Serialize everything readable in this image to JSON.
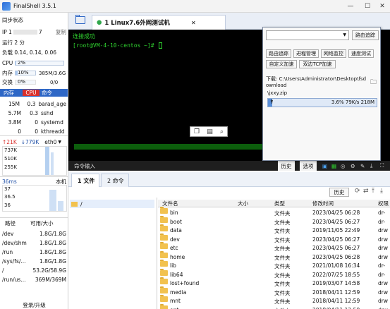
{
  "app": {
    "title": "FinalShell 3.5.1"
  },
  "left": {
    "sync_status": "同步状态",
    "ip_label": "IP 1",
    "ip_tail": "7",
    "copy": "复制",
    "uptime": "运行 2 分",
    "load": "负载 0.14, 0.14, 0.06",
    "cpu": {
      "label": "CPU",
      "value": "2%",
      "percent": 2
    },
    "mem": {
      "label": "内存",
      "percent_text": "10%",
      "value": "385M/3.6G",
      "percent": 10
    },
    "swap": {
      "label": "交换",
      "percent_text": "0%",
      "value": "0/0",
      "percent": 0
    },
    "proc_head": {
      "mem": "内存",
      "cpu": "CPU",
      "cmd": "命令"
    },
    "processes": [
      {
        "mem": "15M",
        "cpu": "0.3",
        "cmd": "barad_age"
      },
      {
        "mem": "5.7M",
        "cpu": "0.3",
        "cmd": "sshd"
      },
      {
        "mem": "3.8M",
        "cpu": "0",
        "cmd": "systemd"
      },
      {
        "mem": "0",
        "cpu": "0",
        "cmd": "kthreadd"
      }
    ],
    "net": {
      "up": "↑21K",
      "down": "↓779K",
      "iface": "eth0"
    },
    "net_ticks": [
      "737K",
      "510K",
      "255K"
    ],
    "latency": {
      "label": "36ms",
      "host": "本机",
      "ticks": [
        "37",
        "36.5",
        "36"
      ]
    },
    "disk_head": {
      "path": "路径",
      "avail": "可用/大小"
    },
    "disks": [
      {
        "path": "/dev",
        "size": "1.8G/1.8G"
      },
      {
        "path": "/dev/shm",
        "size": "1.8G/1.8G"
      },
      {
        "path": "/run",
        "size": "1.8G/1.8G"
      },
      {
        "path": "/sys/fs/...",
        "size": "1.8G/1.8G"
      },
      {
        "path": "/",
        "size": "53.2G/58.9G"
      },
      {
        "path": "/run/us...",
        "size": "369M/369M"
      }
    ],
    "login": "登录/升级"
  },
  "term": {
    "tab_label": "1 Linux7.6外网测试机",
    "connected": "连接成功",
    "prompt": "[root@VM-4-10-centos ~]#",
    "cmd_input": "命令输入",
    "history": "历史",
    "options": "选项"
  },
  "popup": {
    "route_btn": "路由追踪",
    "btns": [
      "路由追踪",
      "进程管理",
      "网络监控",
      "速度测试",
      "自定义加速",
      "双边TCP加速"
    ],
    "download_label": "下载: C:\\Users\\Administrator\\Desktop\\fsdownload",
    "file": "\\jxxy.zip",
    "progress_text": "3.6% 79K/s 218M",
    "progress_percent": 3.6
  },
  "files": {
    "tab1": "1 文件",
    "tab2": "2 命令",
    "history": "历史",
    "root": "/",
    "headers": {
      "name": "文件名",
      "size": "大小",
      "type": "类型",
      "mtime": "修改时间",
      "perm": "权限"
    },
    "rows": [
      {
        "name": "bin",
        "type": "文件夹",
        "mtime": "2023/04/25 06:28",
        "perm": "dr-"
      },
      {
        "name": "boot",
        "type": "文件夹",
        "mtime": "2023/04/25 06:27",
        "perm": "dr-"
      },
      {
        "name": "data",
        "type": "文件夹",
        "mtime": "2019/11/05 22:49",
        "perm": "drw"
      },
      {
        "name": "dev",
        "type": "文件夹",
        "mtime": "2023/04/25 06:27",
        "perm": "drw"
      },
      {
        "name": "etc",
        "type": "文件夹",
        "mtime": "2023/04/25 06:27",
        "perm": "drw"
      },
      {
        "name": "home",
        "type": "文件夹",
        "mtime": "2023/04/25 06:28",
        "perm": "drw"
      },
      {
        "name": "lib",
        "type": "文件夹",
        "mtime": "2021/01/08 16:34",
        "perm": "dr-"
      },
      {
        "name": "lib64",
        "type": "文件夹",
        "mtime": "2022/07/25 18:55",
        "perm": "dr-"
      },
      {
        "name": "lost+found",
        "type": "文件夹",
        "mtime": "2019/03/07 14:58",
        "perm": "drw"
      },
      {
        "name": "media",
        "type": "文件夹",
        "mtime": "2018/04/11 12:59",
        "perm": "drw"
      },
      {
        "name": "mnt",
        "type": "文件夹",
        "mtime": "2018/04/11 12:59",
        "perm": "drw"
      },
      {
        "name": "opt",
        "type": "文件夹",
        "mtime": "2018/04/11 12:59",
        "perm": "drw"
      }
    ]
  }
}
